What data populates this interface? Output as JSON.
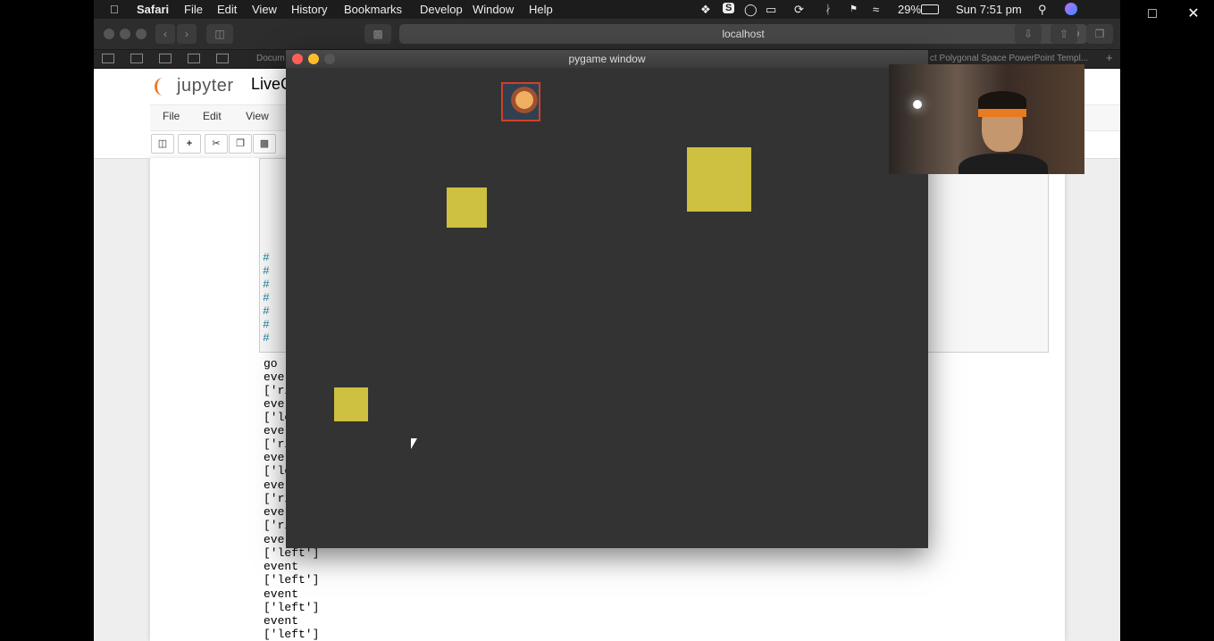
{
  "menubar": {
    "app": "Safari",
    "items": [
      "File",
      "Edit",
      "View",
      "History",
      "Bookmarks",
      "Develop",
      "Window",
      "Help"
    ],
    "battery": "29%",
    "clock": "Sun 7:51 pm"
  },
  "safari": {
    "url": "localhost",
    "tab_left": "Docum",
    "tab_right": "ct Polygonal Space PowerPoint Templ..."
  },
  "jupyter": {
    "logo": "jupyter",
    "title": "LiveC",
    "menu": [
      "File",
      "Edit",
      "View"
    ],
    "hash_lines": [
      "#",
      "#",
      "#",
      "#",
      "#",
      "#",
      "#"
    ],
    "output_lines": [
      "go",
      "ever",
      "['ri",
      "ever",
      "['le",
      "ever",
      "['ri",
      "ever",
      "['le",
      "ever",
      "['ri",
      "ever",
      "['ri",
      "ever",
      "['left']",
      "event",
      "['left']",
      "event",
      "['left']",
      "event",
      "['left']"
    ]
  },
  "pygame": {
    "title": "pygame window",
    "square_color": "#cec040",
    "background": "#333333"
  },
  "colors": {
    "menubar": "#1c1c1c",
    "jupyter_orange": "#f37726"
  },
  "icons": [
    "apple-icon",
    "search-icon",
    "wifi-icon",
    "bluetooth-icon",
    "battery-icon",
    "save-icon",
    "plus-icon",
    "cut-icon",
    "copy-icon",
    "paste-icon"
  ]
}
